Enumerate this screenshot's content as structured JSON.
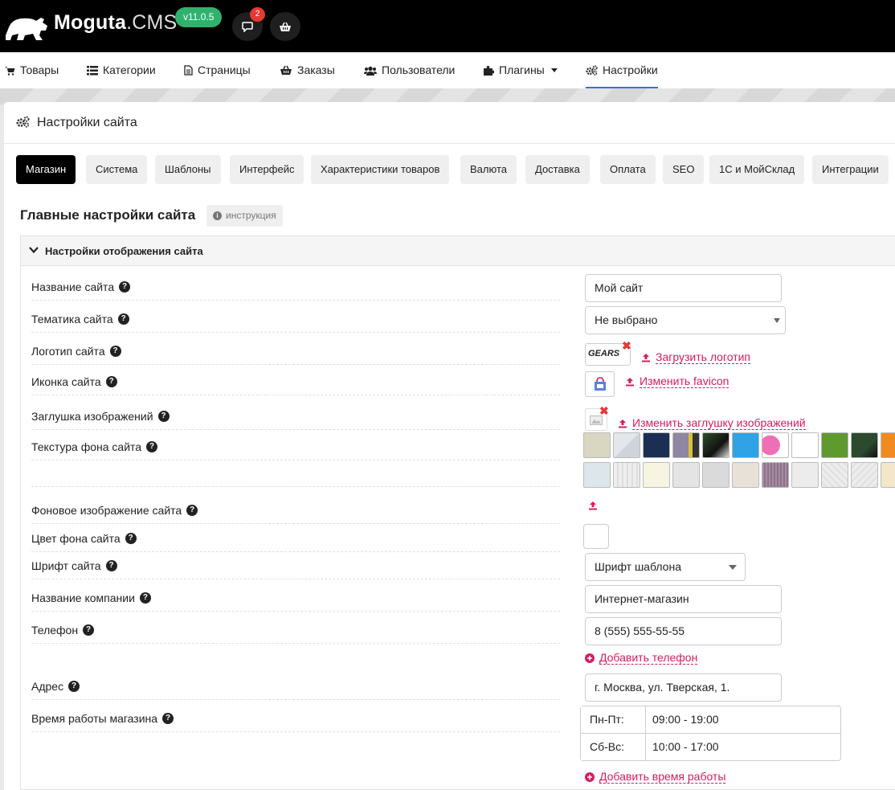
{
  "app": {
    "brand": "Moguta",
    "brand_suffix": ".CMS",
    "version": "v11.0.5",
    "notifications_count": "2"
  },
  "nav": {
    "items": [
      {
        "label": "Товары",
        "icon": "cart-icon"
      },
      {
        "label": "Категории",
        "icon": "list-icon"
      },
      {
        "label": "Страницы",
        "icon": "page-icon"
      },
      {
        "label": "Заказы",
        "icon": "basket-icon"
      },
      {
        "label": "Пользователи",
        "icon": "users-icon"
      },
      {
        "label": "Плагины",
        "icon": "puzzle-icon"
      },
      {
        "label": "Настройки",
        "icon": "gears-icon",
        "active": true
      }
    ]
  },
  "panel": {
    "title": "Настройки сайта",
    "tabs": [
      {
        "label": "Магазин",
        "active": true
      },
      {
        "label": "Система"
      },
      {
        "label": "Шаблоны"
      },
      {
        "label": "Интерфейс"
      },
      {
        "label": "Характеристики товаров"
      },
      {
        "label": "Валюта"
      },
      {
        "label": "Доставка"
      },
      {
        "label": "Оплата"
      },
      {
        "label": "SEO"
      },
      {
        "label": "1С и МойСклад"
      },
      {
        "label": "Интеграции"
      }
    ],
    "section_title": "Главные настройки сайта",
    "instruction_label": "инструкция"
  },
  "accordion": {
    "title": "Настройки отображения сайта"
  },
  "fields": {
    "site_name": {
      "label": "Название сайта",
      "value": "Мой сайт"
    },
    "site_theme": {
      "label": "Тематика сайта",
      "value": "Не выбрано"
    },
    "logo": {
      "label": "Логотип сайта",
      "logo_text": "GEARS",
      "upload_label": "Загрузить логотип"
    },
    "favicon": {
      "label": "Иконка сайта",
      "change_label": "Изменить favicon"
    },
    "placeholder_image": {
      "label": "Заглушка изображений",
      "change_label": "Изменить заглушку изображений"
    },
    "texture": {
      "label": "Текстура фона сайта"
    },
    "bg_image": {
      "label": "Фоновое изображение сайта"
    },
    "bg_color": {
      "label": "Цвет фона сайта"
    },
    "font": {
      "label": "Шрифт сайта",
      "value": "Шрифт шаблона"
    },
    "company": {
      "label": "Название компании",
      "value": "Интернет-магазин"
    },
    "phone": {
      "label": "Телефон",
      "value": "8 (555) 555-55-55",
      "add_label": "Добавить телефон"
    },
    "address": {
      "label": "Адрес",
      "value": "г. Москва, ул. Тверская, 1."
    },
    "hours": {
      "label": "Время работы магазина",
      "rows": [
        {
          "day": "Пн-Пт:",
          "time": "09:00 - 19:00"
        },
        {
          "day": "Сб-Вс:",
          "time": "10:00 - 17:00"
        }
      ],
      "add_label": "Добавить время работы"
    }
  },
  "colors": {
    "accent_pink": "#d81b60",
    "version_green": "#2fb26e",
    "active_tab": "#000000",
    "nav_underline": "#3d6fd6"
  }
}
